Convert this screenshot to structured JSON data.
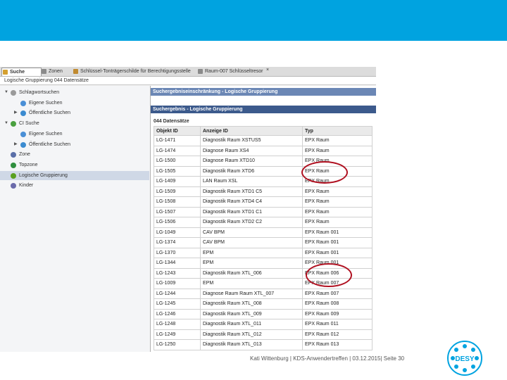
{
  "tabs": [
    {
      "label": "Suche",
      "active": true
    },
    {
      "label": "Zonen",
      "active": false
    },
    {
      "label": "Schlüssel-Tonträgerschilde für Berechtigungsstelle",
      "active": false
    },
    {
      "label": "Raum-007 Schlüsseltresor",
      "active": false
    }
  ],
  "address": "Logische Gruppierung 044 Datensätze",
  "tree": [
    {
      "label": "Schlagwortsuchen",
      "indent": 0,
      "twisty": "▼",
      "icon": "#9a9a9a"
    },
    {
      "label": "Eigene Suchen",
      "indent": 1,
      "twisty": "",
      "icon": "#4a8fd6"
    },
    {
      "label": "Öffentliche Suchen",
      "indent": 1,
      "twisty": "▶",
      "icon": "#3b8bd0"
    },
    {
      "label": "CI Suche",
      "indent": 0,
      "twisty": "▼",
      "icon": "#4aa040"
    },
    {
      "label": "Eigene Suchen",
      "indent": 1,
      "twisty": "",
      "icon": "#4a8fd6"
    },
    {
      "label": "Öffentliche Suchen",
      "indent": 1,
      "twisty": "▶",
      "icon": "#3b8bd0"
    },
    {
      "label": "Zone",
      "indent": 0,
      "twisty": "",
      "icon": "#5a6fa8"
    },
    {
      "label": "Topzone",
      "indent": 0,
      "twisty": "",
      "icon": "#2f8f3f"
    },
    {
      "label": "Logische Gruppierung",
      "indent": 0,
      "twisty": "",
      "icon": "#5aa020",
      "selected": true
    },
    {
      "label": "Kinder",
      "indent": 0,
      "twisty": "",
      "icon": "#6a6aaa"
    }
  ],
  "result_header_1": "Suchergebniseinschränkung - Logische Gruppierung",
  "result_header_2": "Suchergebnis - Logische Gruppierung",
  "count_label": "044 Datensätze",
  "columns": [
    "Objekt ID",
    "Anzeige ID",
    "Typ"
  ],
  "rows": [
    [
      "LG-1471",
      "Diagnostik Raum XSTUS5",
      "EPX Raum"
    ],
    [
      "LG-1474",
      "Diagnose Raum XS4",
      "EPX Raum"
    ],
    [
      "LG-1500",
      "Diagnose Raum XTD10",
      "EPX Raum"
    ],
    [
      "LG-1505",
      "Diagnostik Raum XTD6",
      "EPX Raum"
    ],
    [
      "LG-1409",
      "LAN Raum XSL",
      "EPX Raum"
    ],
    [
      "LG-1509",
      "Diagnostik Raum XTD1 C5",
      "EPX Raum"
    ],
    [
      "LG-1508",
      "Diagnostik Raum XTD4 C4",
      "EPX Raum"
    ],
    [
      "LG-1507",
      "Diagnostik Raum XTD1 C1",
      "EPX Raum"
    ],
    [
      "LG-1506",
      "Diagnostik Raum XTD2 C2",
      "EPX Raum"
    ],
    [
      "LG-1049",
      "CAV BPM",
      "EPX Raum 001"
    ],
    [
      "LG-1374",
      "CAV BPM",
      "EPX Raum 001"
    ],
    [
      "LG-1370",
      "EPM",
      "EPX Raum 001"
    ],
    [
      "LG-1344",
      "EPM",
      "EPX Raum 001"
    ],
    [
      "LG-1243",
      "Diagnostik Raum XTL_006",
      "EPX Raum 006"
    ],
    [
      "LG-1009",
      "EPM",
      "EPX Raum 007"
    ],
    [
      "LG-1244",
      "Diagnose Raum Raum XTL_007",
      "EPX Raum 007"
    ],
    [
      "LG-1245",
      "Diagnostik Raum XTL_008",
      "EPX Raum 008"
    ],
    [
      "LG-1246",
      "Diagnostik Raum XTL_009",
      "EPX Raum 009"
    ],
    [
      "LG-1248",
      "Diagnostik Raum XTL_011",
      "EPX Raum 011"
    ],
    [
      "LG-1249",
      "Diagnostik Raum XTL_012",
      "EPX Raum 012"
    ],
    [
      "LG-1250",
      "Diagnostik Raum XTL_013",
      "EPX Raum 013"
    ]
  ],
  "footer": "Kati Wittenburg | KDS-Anwendertreffen | 03.12.2015| Seite 30",
  "logo_text": "DESY",
  "colors": {
    "topbar": "#00a3e0",
    "header_bar": "#3c5a8c",
    "header_bar_light": "#6b87b5",
    "annotation": "#b01020"
  }
}
